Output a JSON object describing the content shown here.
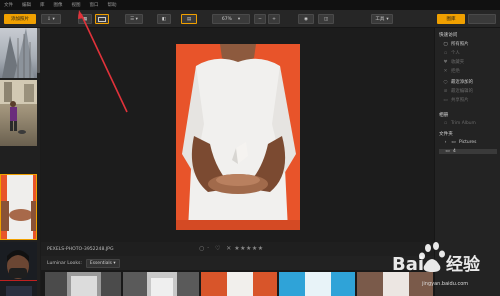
{
  "menubar": {
    "items": [
      "文件",
      "编辑",
      "库",
      "图像",
      "视图",
      "窗口",
      "帮助"
    ]
  },
  "toolbar": {
    "add_photos": "添加照片",
    "zoom": "67%",
    "minus": "−",
    "plus": "+",
    "tools": "工具",
    "library": "图库"
  },
  "main": {
    "filename": "PEXELS-PHOTO-3952248.JPG",
    "rating_stars": "✕ ★★★★★",
    "looks_label": "Luminar Looks:",
    "looks_select": "Essentials"
  },
  "panel": {
    "quick_access_title": "快速访问",
    "items": [
      {
        "label": "所有照片",
        "dim": false
      },
      {
        "label": "个人",
        "dim": true
      },
      {
        "label": "收藏夹",
        "dim": true
      },
      {
        "label": "拒绝",
        "dim": true
      },
      {
        "label": "最近添加的",
        "dim": false
      },
      {
        "label": "最近编辑的",
        "dim": true
      },
      {
        "label": "共享照片",
        "dim": true
      }
    ],
    "albums_title": "相册",
    "albums_item": "Trim Album",
    "folders_title": "文件夹",
    "folder_root": "Pictures",
    "folder_sub": "4"
  },
  "watermark": {
    "text": "Bai 经验",
    "sub": "jingyan.baidu.com"
  },
  "colors": {
    "accent": "#f0a000",
    "photo_bg": "#e8542a",
    "arrow": "#e0323a"
  },
  "icons": [
    "menu-icon",
    "download-icon",
    "grid-icon",
    "single-view-icon",
    "eye-icon",
    "compare-icon",
    "folder-icon",
    "heart-icon",
    "flag-icon"
  ]
}
